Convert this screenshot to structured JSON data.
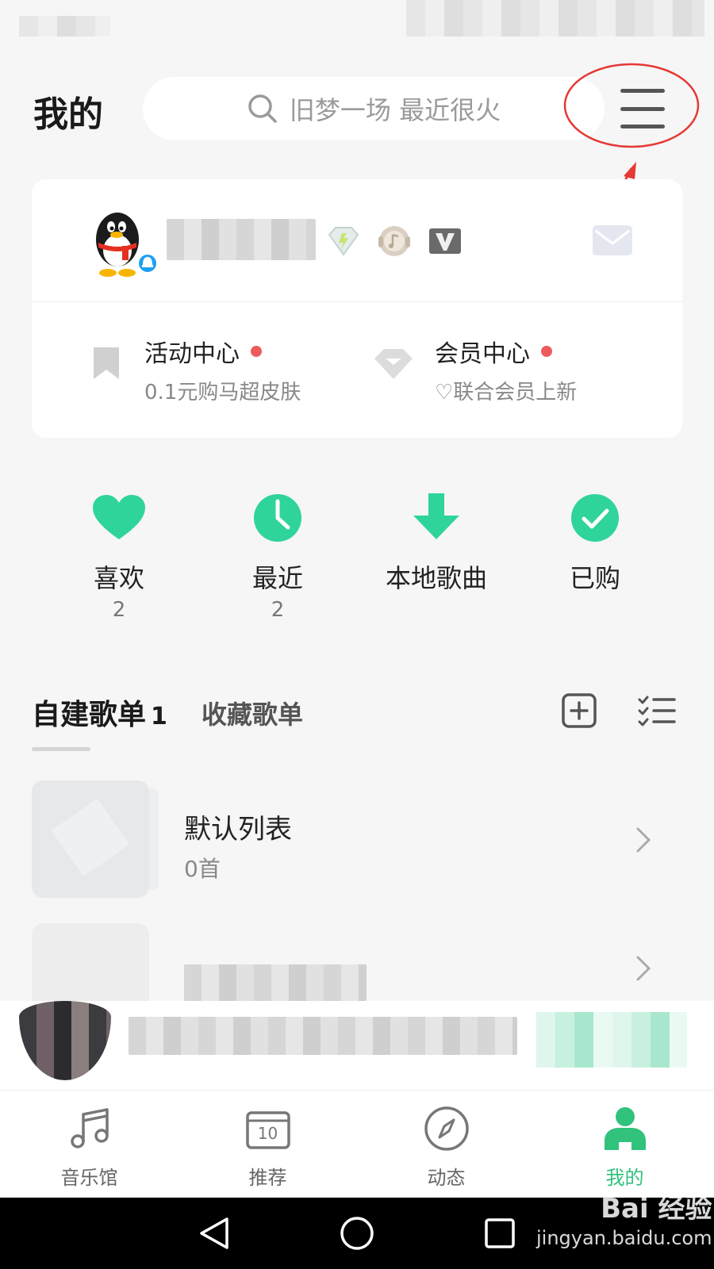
{
  "header": {
    "title": "我的",
    "search_placeholder": "旧梦一场 最近很火"
  },
  "promos": [
    {
      "title": "活动中心",
      "subtitle": "0.1元购马超皮肤"
    },
    {
      "title": "会员中心",
      "subtitle": "♡联合会员上新"
    }
  ],
  "shortcuts": [
    {
      "label": "喜欢",
      "count": "2"
    },
    {
      "label": "最近",
      "count": "2"
    },
    {
      "label": "本地歌曲",
      "count": ""
    },
    {
      "label": "已购",
      "count": ""
    }
  ],
  "playlist_tabs": {
    "own_label": "自建歌单",
    "own_count": "1",
    "fav_label": "收藏歌单"
  },
  "playlists": [
    {
      "name": "默认列表",
      "count": "0首"
    }
  ],
  "bottom_nav": [
    {
      "label": "音乐馆",
      "icon": "music-note-icon"
    },
    {
      "label": "推荐",
      "icon": "calendar-icon",
      "icon_text": "10"
    },
    {
      "label": "动态",
      "icon": "compass-icon"
    },
    {
      "label": "我的",
      "icon": "user-icon",
      "active": true
    }
  ],
  "watermark": {
    "main": "Bai 经验",
    "url": "jingyan.baidu.com"
  },
  "colors": {
    "accent": "#31c27c",
    "icon_green": "#2fd49a",
    "annotation_red": "#e53935"
  }
}
